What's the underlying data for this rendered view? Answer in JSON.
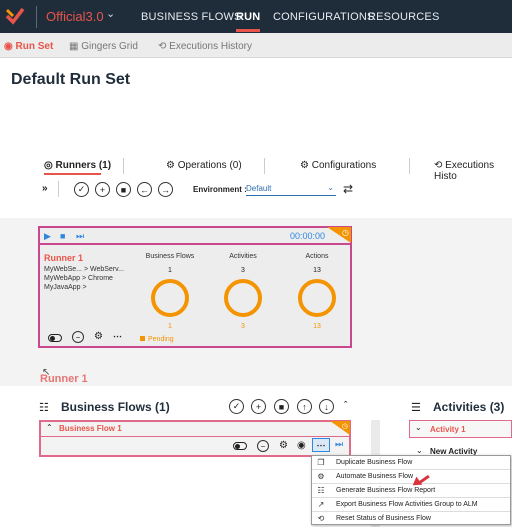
{
  "app": {
    "name": "Official3.0"
  },
  "nav": [
    "BUSINESS FLOWS",
    "RUN",
    "CONFIGURATIONS",
    "RESOURCES"
  ],
  "subtabs": [
    "Run Set",
    "Gingers Grid",
    "Executions History"
  ],
  "page_title": "Default Run Set",
  "runner_tabs": [
    "Runners (1)",
    "Operations (0)",
    "Configurations",
    "Executions Histo"
  ],
  "environment": {
    "label": "Environment :",
    "value": "Default"
  },
  "runner_card": {
    "timer": "00:00:00",
    "name": "Runner 1",
    "flows": [
      "MyWebSe... > WebServ...",
      "MyWebApp > Chrome",
      "MyJavaApp >"
    ],
    "columns": [
      {
        "label": "Business Flows",
        "top": "1",
        "bottom": "1"
      },
      {
        "label": "Activities",
        "top": "3",
        "bottom": "3"
      },
      {
        "label": "Actions",
        "top": "13",
        "bottom": "13"
      }
    ],
    "status": "Pending"
  },
  "runner_title": "Runner 1",
  "business_flows": {
    "title": "Business Flows (1)",
    "flow_name": "Business Flow 1"
  },
  "activities": {
    "title": "Activities (3)",
    "activity_name": "Activity 1",
    "group_name": "New Activity"
  },
  "context_menu": [
    {
      "label": "Duplicate Business Flow",
      "icon": "duplicate-icon"
    },
    {
      "label": "Automate Business Flow",
      "icon": "gears-icon"
    },
    {
      "label": "Generate Business Flow Report",
      "icon": "report-icon"
    },
    {
      "label": "Export Business Flow Activities Group to ALM",
      "icon": "export-icon"
    },
    {
      "label": "Reset Status of Business Flow",
      "icon": "reset-icon"
    }
  ],
  "colors": {
    "accent": "#e9544a",
    "orange": "#f39400",
    "pink": "#c9478e",
    "topbar": "#1f2d3b",
    "blue": "#2e86de"
  }
}
